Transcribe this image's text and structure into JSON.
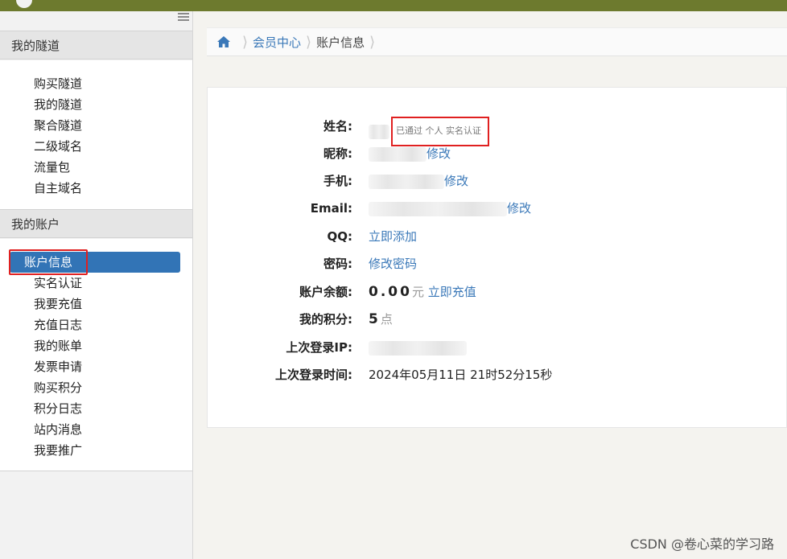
{
  "sidebar": {
    "sections": [
      {
        "title": "我的隧道",
        "items": [
          "购买隧道",
          "我的隧道",
          "聚合隧道",
          "二级域名",
          "流量包",
          "自主域名"
        ]
      },
      {
        "title": "我的账户",
        "items": [
          "账户信息",
          "实名认证",
          "我要充值",
          "充值日志",
          "我的账单",
          "发票申请",
          "购买积分",
          "积分日志",
          "站内消息",
          "我要推广"
        ]
      }
    ],
    "active_item": "账户信息"
  },
  "breadcrumb": {
    "items": [
      "会员中心",
      "账户信息"
    ]
  },
  "account": {
    "name_label": "姓名:",
    "verified_text": "已通过 个人 实名认证",
    "nickname_label": "昵称:",
    "nickname_edit": "修改",
    "phone_label": "手机:",
    "phone_edit": "修改",
    "email_label": "Email:",
    "email_edit": "修改",
    "qq_label": "QQ:",
    "qq_action": "立即添加",
    "password_label": "密码:",
    "password_action": "修改密码",
    "balance_label": "账户余额:",
    "balance_value": "0.00",
    "balance_unit": "元",
    "balance_action": "立即充值",
    "points_label": "我的积分:",
    "points_value": "5",
    "points_unit": "点",
    "last_ip_label": "上次登录IP:",
    "last_login_label": "上次登录时间:",
    "last_login_value": "2024年05月11日 21时52分15秒"
  },
  "watermark": "CSDN @卷心菜的学习路",
  "colors": {
    "topbar": "#6d7a2e",
    "accent": "#3274b6",
    "link": "#3a78b8",
    "highlight": "#e02020"
  }
}
